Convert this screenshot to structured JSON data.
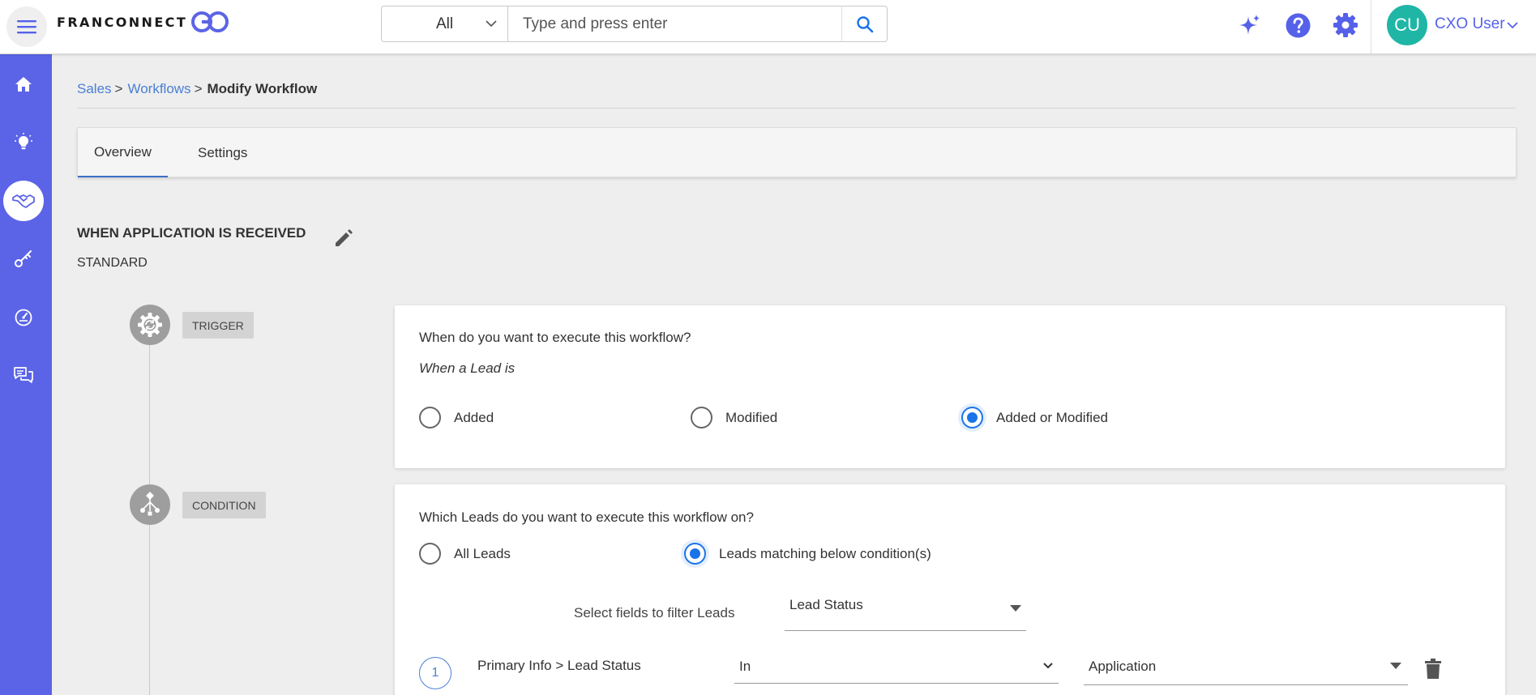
{
  "header": {
    "brand": "FRANCONNECT",
    "search": {
      "category": "All",
      "placeholder": "Type and press enter"
    },
    "user": {
      "initials": "CU",
      "name": "CXO User"
    }
  },
  "sidebar": {
    "items": [
      {
        "icon": "home-icon"
      },
      {
        "icon": "lightbulb-icon"
      },
      {
        "icon": "handshake-icon",
        "active": true
      },
      {
        "icon": "key-icon"
      },
      {
        "icon": "gauge-icon"
      },
      {
        "icon": "chat-icon"
      }
    ]
  },
  "breadcrumb": {
    "items": [
      "Sales",
      "Workflows"
    ],
    "separator": ">",
    "current": "Modify Workflow"
  },
  "tabs": [
    {
      "label": "Overview",
      "active": true
    },
    {
      "label": "Settings",
      "active": false
    }
  ],
  "workflow": {
    "title": "WHEN APPLICATION IS RECEIVED",
    "type": "STANDARD"
  },
  "trigger": {
    "badge": "TRIGGER",
    "question": "When do you want to execute this workflow?",
    "subtitle": "When a Lead is",
    "options": [
      "Added",
      "Modified",
      "Added or Modified"
    ],
    "selected": "Added or Modified"
  },
  "condition": {
    "badge": "CONDITION",
    "question": "Which Leads do you want to execute this workflow on?",
    "options": [
      "All Leads",
      "Leads matching below condition(s)"
    ],
    "selected": "Leads matching below condition(s)",
    "filter_label": "Select fields to filter Leads",
    "filter_field": "Lead Status",
    "rows": [
      {
        "number": "1",
        "field": "Primary Info > Lead Status",
        "operator": "In",
        "value": "Application"
      }
    ]
  },
  "colors": {
    "sidebar": "#5b64e6",
    "accent": "#5561e8",
    "avatar": "#1fb6a6",
    "link": "#4a7fd4",
    "radio": "#1a73e8"
  }
}
